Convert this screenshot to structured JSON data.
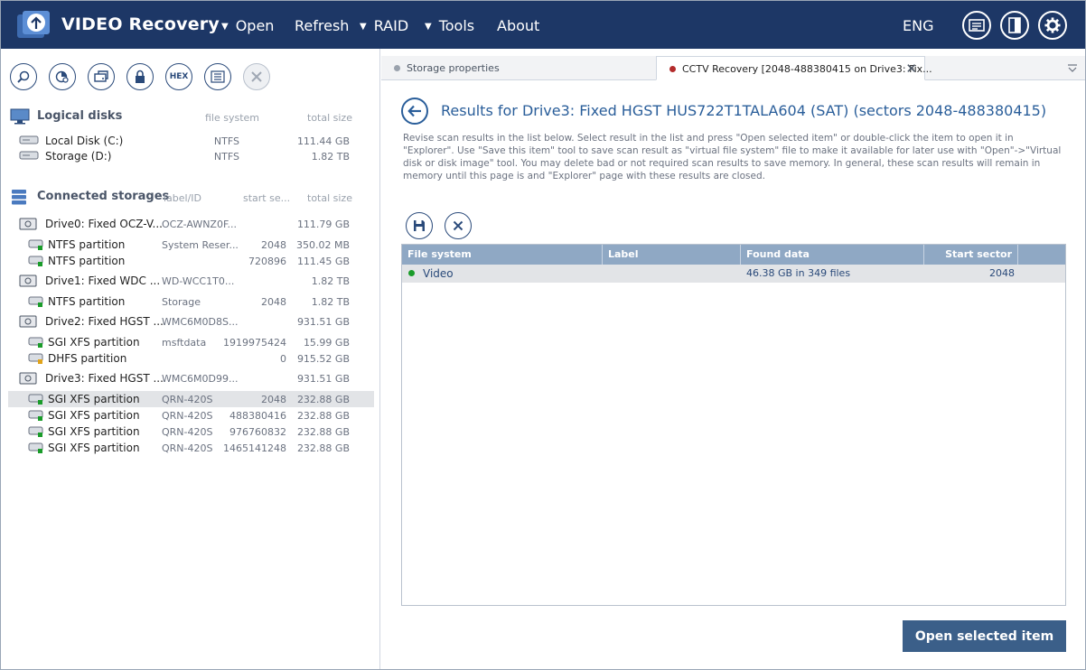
{
  "app": {
    "title": "VIDEO Recovery"
  },
  "menu": {
    "open": "Open",
    "refresh": "Refresh",
    "raid": "RAID",
    "tools": "Tools",
    "about": "About",
    "caret": "▼",
    "language": "ENG"
  },
  "left": {
    "logical_disks": {
      "title": "Logical disks",
      "col_fs": "file system",
      "col_size": "total size",
      "items": [
        {
          "name": "Local Disk (C:)",
          "fs": "NTFS",
          "size": "111.44 GB"
        },
        {
          "name": "Storage (D:)",
          "fs": "NTFS",
          "size": "1.82 TB"
        }
      ]
    },
    "connected": {
      "title": "Connected storages",
      "col_label": "label/ID",
      "col_start": "start se...",
      "col_size": "total size",
      "rows": [
        {
          "name": "Drive0: Fixed OCZ-V...",
          "label": "OCZ-AWNZ0F...",
          "start": "",
          "size": "111.79 GB"
        },
        {
          "name": "NTFS partition",
          "label": "System Reser...",
          "start": "2048",
          "size": "350.02 MB"
        },
        {
          "name": "NTFS partition",
          "label": "",
          "start": "720896",
          "size": "111.45 GB"
        },
        {
          "name": "Drive1: Fixed WDC ...",
          "label": "WD-WCC1T0...",
          "start": "",
          "size": "1.82 TB"
        },
        {
          "name": "NTFS partition",
          "label": "Storage",
          "start": "2048",
          "size": "1.82 TB"
        },
        {
          "name": "Drive2: Fixed HGST ...",
          "label": "WMC6M0D8S...",
          "start": "",
          "size": "931.51 GB"
        },
        {
          "name": "SGI XFS partition",
          "label": "msftdata",
          "start": "1919975424",
          "size": "15.99 GB"
        },
        {
          "name": "DHFS partition",
          "label": "",
          "start": "0",
          "size": "915.52 GB"
        },
        {
          "name": "Drive3: Fixed HGST ...",
          "label": "WMC6M0D99...",
          "start": "",
          "size": "931.51 GB"
        },
        {
          "name": "SGI XFS partition",
          "label": "QRN-420S",
          "start": "2048",
          "size": "232.88 GB"
        },
        {
          "name": "SGI XFS partition",
          "label": "QRN-420S",
          "start": "488380416",
          "size": "232.88 GB"
        },
        {
          "name": "SGI XFS partition",
          "label": "QRN-420S",
          "start": "976760832",
          "size": "232.88 GB"
        },
        {
          "name": "SGI XFS partition",
          "label": "QRN-420S",
          "start": "1465141248",
          "size": "232.88 GB"
        }
      ]
    },
    "toolbar_hex": "HEX"
  },
  "tabs": {
    "storage": "Storage properties",
    "cctv": "CCTV Recovery [2048-488380415 on Drive3: Fix...",
    "close": "✕"
  },
  "results": {
    "title": "Results for Drive3: Fixed HGST HUS722T1TALA604 (SAT) (sectors 2048-488380415)",
    "description": "Revise scan results in the list below. Select result in the list and press \"Open selected item\" or double-click the item to open it in \"Explorer\". Use \"Save this item\" tool to save scan result as \"virtual file system\" file to make it available for later use with \"Open\"->\"Virtual disk or disk image\" tool. You may delete bad or not required scan results to save memory. In general, these scan results will remain in memory until this page is and \"Explorer\" page with these results are closed.",
    "columns": {
      "fs": "File system",
      "label": "Label",
      "found": "Found data",
      "start": "Start sector"
    },
    "row": {
      "fs": "Video",
      "label": "",
      "found": "46.38 GB in 349 files",
      "start": "2048"
    },
    "open_button": "Open selected item"
  },
  "colors": {
    "topbar": "#1d3766",
    "accent": "#2a5e9a",
    "header": "#8fa8c4",
    "button": "#3b5f89",
    "dot_green": "#1a9c2a",
    "dot_red": "#b32b2b"
  }
}
